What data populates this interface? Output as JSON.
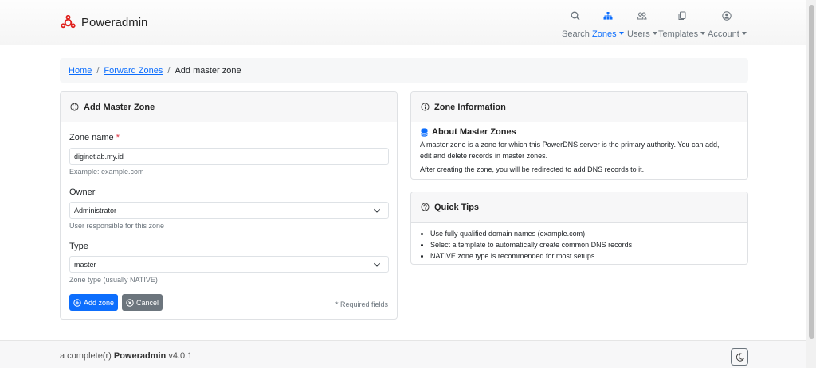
{
  "brand": {
    "name": "Poweradmin",
    "color": "#e0201c"
  },
  "nav": {
    "search": "Search",
    "zones": "Zones",
    "users": "Users",
    "templates": "Templates",
    "account": "Account"
  },
  "breadcrumb": {
    "home": "Home",
    "forward_zones": "Forward Zones",
    "separator": "/",
    "current": "Add master zone"
  },
  "form": {
    "title": "Add Master Zone",
    "zone_name_label": "Zone name",
    "required_mark": "*",
    "zone_name_value": "diginetlab.my.id",
    "zone_name_help": "Example: example.com",
    "owner_label": "Owner",
    "owner_value": "Administrator",
    "owner_help": "User responsible for this zone",
    "type_label": "Type",
    "type_value": "master",
    "type_help": "Zone type (usually NATIVE)",
    "add_button": "Add zone",
    "cancel_button": "Cancel",
    "required_note": "* Required fields"
  },
  "zone_info": {
    "title": "Zone Information",
    "heading": "About Master Zones",
    "line1": "A master zone is a zone for which this PowerDNS server is the primary authority. You can add,",
    "line2": "edit and delete records in master zones.",
    "line3": "After creating the zone, you will be redirected to add DNS records to it."
  },
  "tips": {
    "title": "Quick Tips",
    "items": [
      "Use fully qualified domain names (example.com)",
      "Select a template to automatically create common DNS records",
      "NATIVE zone type is recommended for most setups"
    ]
  },
  "footer": {
    "prefix": "a complete(r)",
    "brand": "Poweradmin",
    "version": "v4.0.1"
  },
  "colors": {
    "primary": "#0d6efd",
    "secondary": "#6c757d",
    "danger": "#dc3545"
  }
}
